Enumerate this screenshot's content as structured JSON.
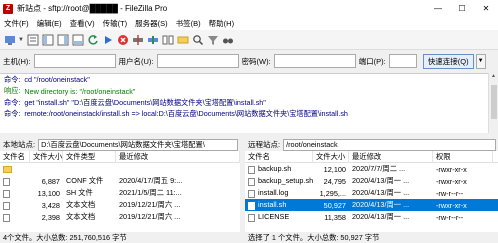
{
  "window": {
    "title": "新站点 - sftp://root@█████ - FileZilla Pro",
    "minimize": "—",
    "maximize": "☐",
    "close": "✕"
  },
  "menu": [
    "文件(F)",
    "编辑(E)",
    "查看(V)",
    "传输(T)",
    "服务器(S)",
    "书签(B)",
    "帮助(H)"
  ],
  "quickconnect": {
    "host_label": "主机(H):",
    "user_label": "用户名(U):",
    "pass_label": "密码(W):",
    "port_label": "端口(P):",
    "connect_label": "快速连接(Q)",
    "host_value": "",
    "user_value": "",
    "pass_value": "",
    "port_value": ""
  },
  "log": [
    {
      "prefix": "命令:",
      "text": "cd \"/root/oneinstack\"",
      "kind": "cmd"
    },
    {
      "prefix": "响应:",
      "text": "New directory is: \"/root/oneinstack\"",
      "kind": "ok"
    },
    {
      "prefix": "命令:",
      "text": "get \"install.sh\" \"D:\\百度云盘\\Documents\\网站数据文件夹\\宝塔配置\\install.sh\"",
      "kind": "cmd"
    },
    {
      "prefix": "命令:",
      "text": "remote:/root/oneinstack/install.sh => local:D:\\百度云盘\\Documents\\网站数据文件夹\\宝塔配置\\install.sh",
      "kind": "cmd"
    }
  ],
  "local": {
    "addr_label": "本地站点:",
    "path": "D:\\百度云盘\\Documents\\网站数据文件夹\\宝塔配置\\",
    "columns": [
      "文件名",
      "文件大小",
      "文件类型",
      "最近修改"
    ],
    "rows": [
      {
        "name": "",
        "size": "",
        "type": "",
        "modified": "",
        "icon": "folder"
      },
      {
        "name": "",
        "size": "6,887",
        "type": "CONF 文件",
        "modified": "2020/4/17/周五 9:...",
        "icon": "doc"
      },
      {
        "name": "",
        "size": "13,100",
        "type": "SH 文件",
        "modified": "2021/1/5/周二 11:...",
        "icon": "doc"
      },
      {
        "name": "",
        "size": "3,428",
        "type": "文本文档",
        "modified": "2019/12/21/周六 ...",
        "icon": "doc"
      },
      {
        "name": "",
        "size": "2,398",
        "type": "文本文档",
        "modified": "2019/12/21/周六 ...",
        "icon": "doc"
      }
    ],
    "status": "4个文件。大小总数: 251,760,516 字节"
  },
  "remote": {
    "addr_label": "远程站点:",
    "path": "/root/oneinstack",
    "columns": [
      "文件名",
      "文件大小",
      "最近修改",
      "权限"
    ],
    "rows": [
      {
        "name": "backup.sh",
        "size": "12,100",
        "modified": "2020/7/7/周二 ...",
        "perm": "-rwxr-xr-x",
        "selected": false
      },
      {
        "name": "backup_setup.sh",
        "size": "24,795",
        "modified": "2020/4/13/周一 ...",
        "perm": "-rwxr-xr-x",
        "selected": false
      },
      {
        "name": "install.log",
        "size": "1,295,...",
        "modified": "2020/4/13/周一 ...",
        "perm": "-rw-r--r--",
        "selected": false
      },
      {
        "name": "install.sh",
        "size": "50,927",
        "modified": "2020/4/13/周一 ...",
        "perm": "-rwxr-xr-x",
        "selected": true
      },
      {
        "name": "LICENSE",
        "size": "11,358",
        "modified": "2020/4/13/周一 ...",
        "perm": "-rw-r--r--",
        "selected": false
      }
    ],
    "status": "选择了 1 个文件。大小总数: 50,927 字节"
  }
}
